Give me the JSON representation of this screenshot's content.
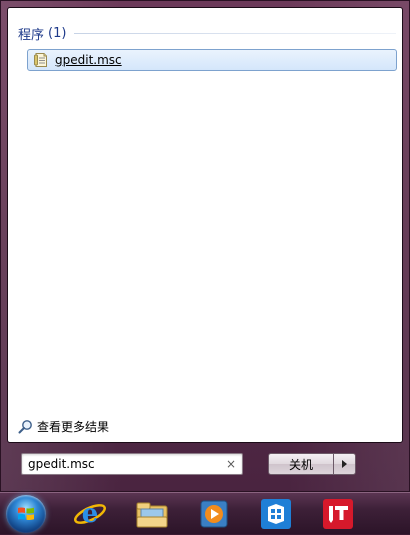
{
  "results": {
    "section_title": "程序",
    "section_count": "(1)",
    "items": [
      {
        "label": "gpedit.msc",
        "icon": "document-icon"
      }
    ]
  },
  "see_more": {
    "label": "查看更多结果",
    "icon": "search-icon"
  },
  "search": {
    "value": "gpedit.msc",
    "clear_symbol": "×"
  },
  "shutdown": {
    "label": "关机"
  },
  "taskbar": {
    "pinned": [
      "internet-explorer-icon",
      "file-explorer-icon",
      "media-player-icon",
      "store-app-icon",
      "it-app-icon"
    ]
  },
  "colors": {
    "accent_blue": "#1e3a8a",
    "frame_purple": "#5a2d4a",
    "selection_border": "#7da2ce",
    "it_red": "#d6192b"
  }
}
